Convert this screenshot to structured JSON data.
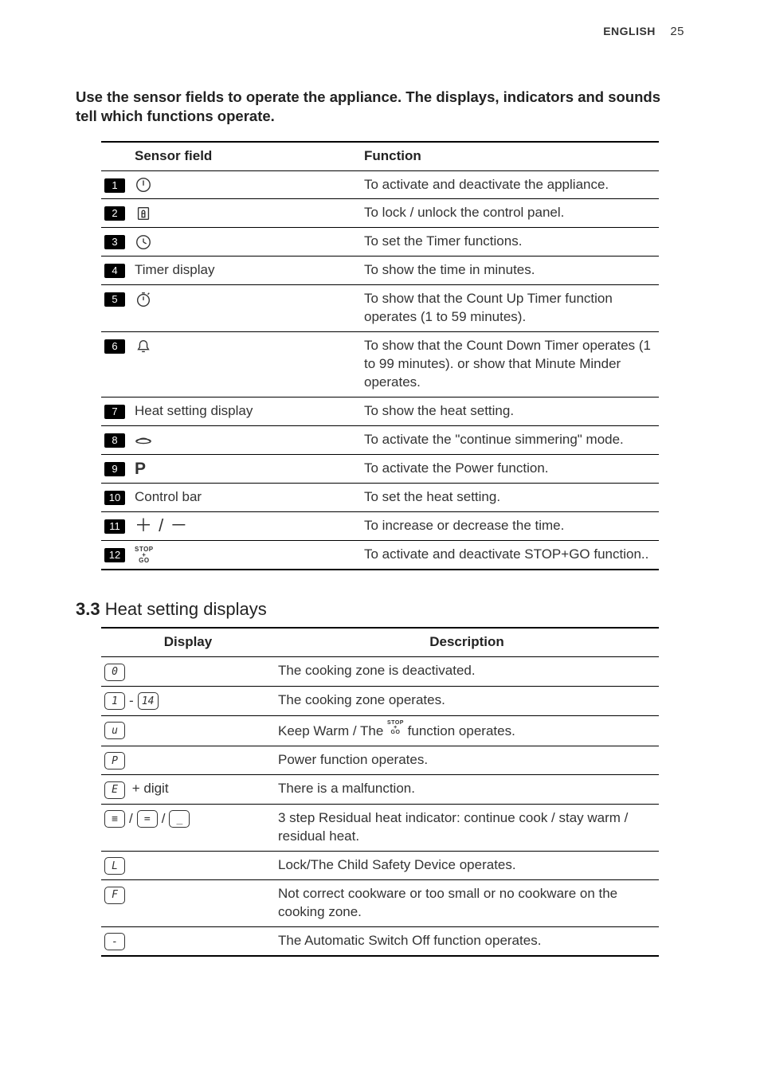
{
  "header": {
    "lang": "ENGLISH",
    "page": "25"
  },
  "intro": "Use the sensor fields to operate the appliance. The displays, indicators and sounds tell which functions operate.",
  "sensor_table": {
    "head": {
      "num": "",
      "sf": "Sensor field",
      "fn": "Function"
    },
    "rows": [
      {
        "n": "1",
        "sf_kind": "icon",
        "sf_icon": "power-icon",
        "sf_text": "",
        "fn": "To activate and deactivate the appliance."
      },
      {
        "n": "2",
        "sf_kind": "icon",
        "sf_icon": "lock-icon",
        "sf_text": "",
        "fn": "To lock / unlock the control panel."
      },
      {
        "n": "3",
        "sf_kind": "icon",
        "sf_icon": "clock-icon",
        "sf_text": "",
        "fn": "To set the Timer functions."
      },
      {
        "n": "4",
        "sf_kind": "text",
        "sf_icon": "",
        "sf_text": "Timer display",
        "fn": "To show the time in minutes."
      },
      {
        "n": "5",
        "sf_kind": "icon",
        "sf_icon": "countup-icon",
        "sf_text": "",
        "fn": "To show that the Count Up Timer function operates (1 to 59 minutes)."
      },
      {
        "n": "6",
        "sf_kind": "icon",
        "sf_icon": "bell-icon",
        "sf_text": "",
        "fn": "To show that the Count Down Timer operates (1 to 99 minutes). or show that Minute Minder operates."
      },
      {
        "n": "7",
        "sf_kind": "text",
        "sf_icon": "",
        "sf_text": "Heat setting display",
        "fn": "To show the heat setting."
      },
      {
        "n": "8",
        "sf_kind": "icon",
        "sf_icon": "simmer-icon",
        "sf_text": "",
        "fn": "To activate the \"continue simmering\" mode."
      },
      {
        "n": "9",
        "sf_kind": "icon",
        "sf_icon": "power-p",
        "sf_text": "",
        "fn": "To activate the Power function."
      },
      {
        "n": "10",
        "sf_kind": "text",
        "sf_icon": "",
        "sf_text": "Control bar",
        "fn": "To set the heat setting."
      },
      {
        "n": "11",
        "sf_kind": "icon",
        "sf_icon": "plus-minus",
        "sf_text": "",
        "fn": "To increase or decrease the time."
      },
      {
        "n": "12",
        "sf_kind": "icon",
        "sf_icon": "stopgo",
        "sf_text": "",
        "fn": "To activate and deactivate STOP+GO function.."
      }
    ]
  },
  "section33": {
    "num": "3.3",
    "title": "Heat setting displays"
  },
  "display_table": {
    "head": {
      "disp": "Display",
      "desc": "Description"
    },
    "rows": [
      {
        "disp_kind": "seg",
        "disp": [
          "0"
        ],
        "suffix": "",
        "desc": "The cooking zone is deactivated."
      },
      {
        "disp_kind": "segpair",
        "disp": [
          "1",
          "14"
        ],
        "mid": " - ",
        "suffix": "",
        "desc": "The cooking zone operates."
      },
      {
        "disp_kind": "seg",
        "disp": [
          "u"
        ],
        "suffix": "",
        "desc_pre": "Keep Warm / The ",
        "desc_post": " function operates."
      },
      {
        "disp_kind": "seg",
        "disp": [
          "P"
        ],
        "suffix": "",
        "desc": "Power function operates."
      },
      {
        "disp_kind": "seg",
        "disp": [
          "E"
        ],
        "suffix": " + digit",
        "desc": "There is a malfunction."
      },
      {
        "disp_kind": "segtrip",
        "disp": [
          "≡",
          "=",
          "_"
        ],
        "mid": " / ",
        "suffix": "",
        "desc": "3 step Residual heat indicator: continue cook / stay warm / residual heat."
      },
      {
        "disp_kind": "seg",
        "disp": [
          "L"
        ],
        "suffix": "",
        "desc": "Lock/The Child Safety Device operates."
      },
      {
        "disp_kind": "seg",
        "disp": [
          "F"
        ],
        "suffix": "",
        "desc": "Not correct cookware or too small or no cookware on the cooking zone."
      },
      {
        "disp_kind": "seg",
        "disp": [
          "-"
        ],
        "suffix": "",
        "desc": "The Automatic Switch Off function operates."
      }
    ]
  }
}
